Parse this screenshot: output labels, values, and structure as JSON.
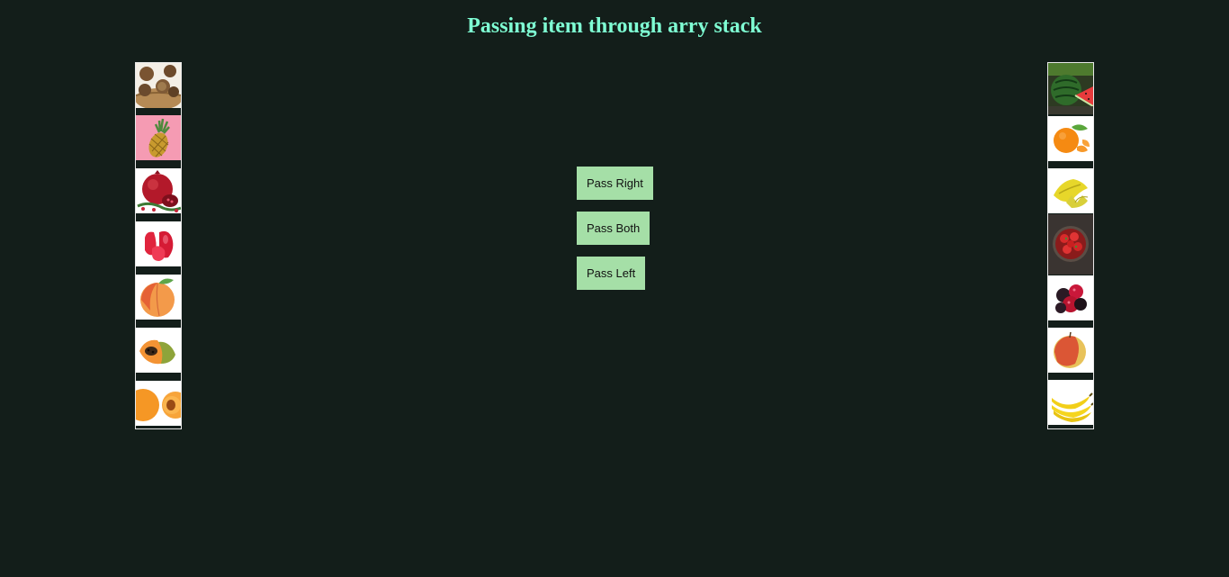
{
  "page": {
    "title": "Passing item through arry stack"
  },
  "controls": {
    "pass_right": "Pass Right",
    "pass_both": "Pass Both",
    "pass_left": "Pass Left"
  },
  "left_stack": {
    "items": [
      "kiwi",
      "pineapple",
      "pomegranate",
      "rose-apple",
      "peach",
      "papaya",
      "apricot"
    ]
  },
  "right_stack": {
    "items": [
      "watermelon",
      "tangerine",
      "starfruit",
      "strawberries",
      "blackberries",
      "apple",
      "banana"
    ]
  },
  "colors": {
    "background": "#131e1a",
    "title": "#7fffd4",
    "button": "#a5dfa7"
  }
}
